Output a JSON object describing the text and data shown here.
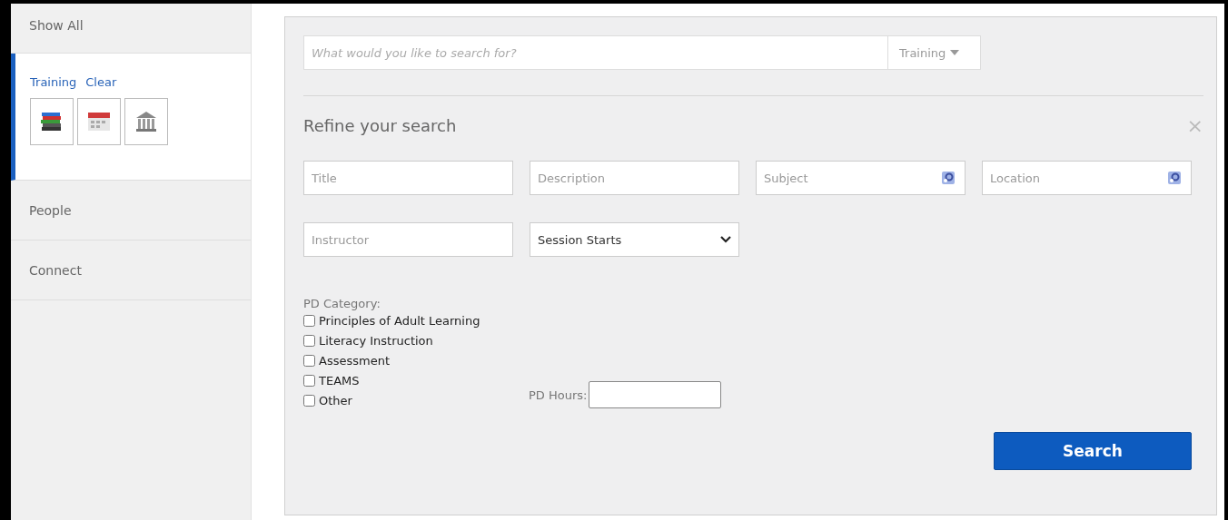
{
  "sidebar": {
    "items": [
      {
        "label": "Show All",
        "selected": false
      },
      {
        "label": "Training",
        "selected": true,
        "action": "Clear"
      },
      {
        "label": "People",
        "selected": false
      },
      {
        "label": "Connect",
        "selected": false
      }
    ]
  },
  "search": {
    "placeholder": "What would you like to search for?",
    "scope": "Training"
  },
  "refine": {
    "title": "Refine your search",
    "close": "×",
    "fields": [
      {
        "kind": "text",
        "placeholder": "Title"
      },
      {
        "kind": "text",
        "placeholder": "Description"
      },
      {
        "kind": "lookup",
        "placeholder": "Subject"
      },
      {
        "kind": "lookup",
        "placeholder": "Location"
      },
      {
        "kind": "text",
        "placeholder": "Instructor"
      },
      {
        "kind": "select",
        "value": "Session Starts"
      }
    ],
    "category_label": "PD Category:",
    "categories": [
      {
        "label": "Principles of Adult Learning",
        "checked": false
      },
      {
        "label": "Literacy Instruction",
        "checked": false
      },
      {
        "label": "Assessment",
        "checked": false
      },
      {
        "label": "TEAMS",
        "checked": false
      },
      {
        "label": "Other",
        "checked": false
      }
    ],
    "hours_label": "PD Hours:",
    "button": "Search"
  }
}
